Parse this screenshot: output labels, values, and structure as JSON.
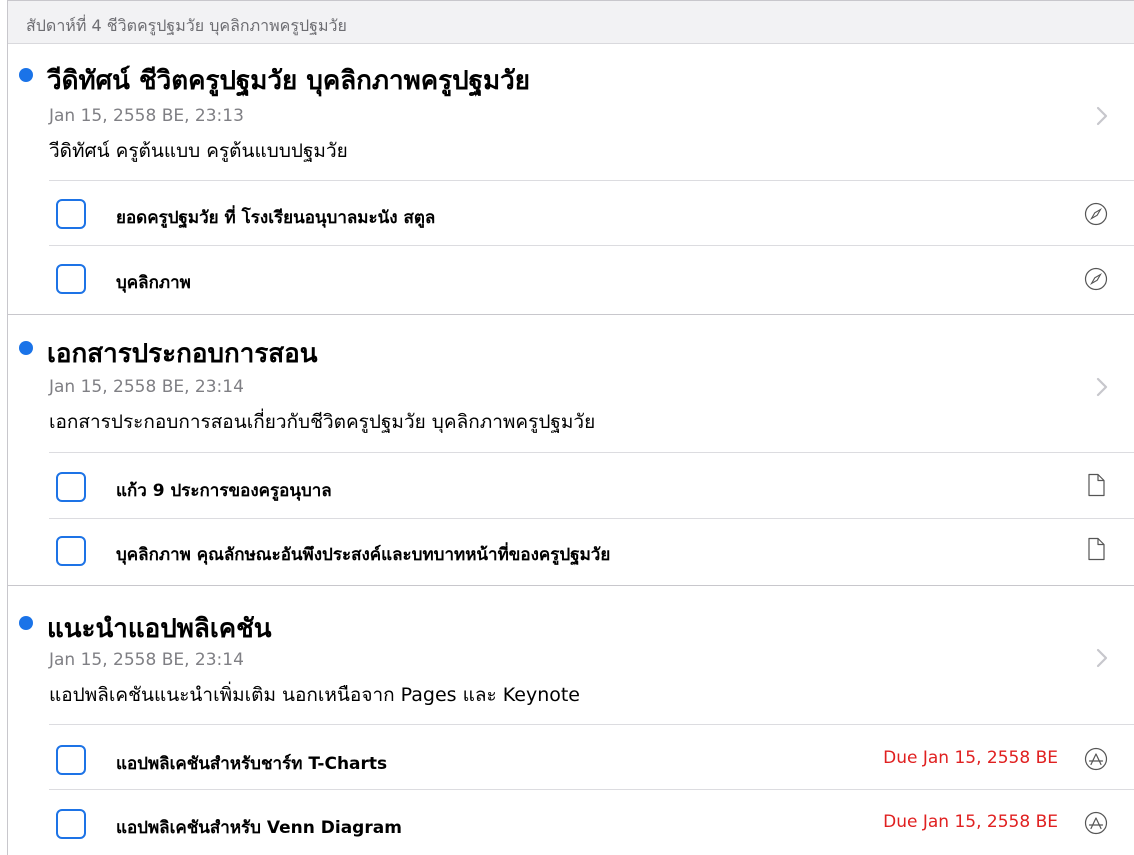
{
  "header": {
    "title": "สัปดาห์ที่ 4 ชีวิตครูปฐมวัย บุคลิกภาพครูปฐมวัย"
  },
  "colors": {
    "accent": "#1a73e8",
    "due": "#e02020",
    "secondary_text": "#7f7f84"
  },
  "groups": [
    {
      "title": "วีดิทัศน์ ชีวิตครูปฐมวัย บุคลิกภาพครูปฐมวัย",
      "date": "Jan 15, 2558 BE, 23:13",
      "description": "วีดิทัศน์ ครูต้นแบบ ครูต้นแบบปฐมวัย",
      "items": [
        {
          "label": "ยอดครูปฐมวัย ที่ โรงเรียนอนุบาลมะนัง สตูล",
          "due": "",
          "icon": "compass-icon"
        },
        {
          "label": "บุคลิกภาพ",
          "due": "",
          "icon": "compass-icon"
        }
      ]
    },
    {
      "title": "เอกสารประกอบการสอน",
      "date": "Jan 15, 2558 BE, 23:14",
      "description": "เอกสารประกอบการสอนเกี่ยวกับชีวิตครูปฐมวัย บุคลิกภาพครูปฐมวัย",
      "items": [
        {
          "label": "แก้ว 9 ประการของครูอนุบาล",
          "due": "",
          "icon": "document-icon"
        },
        {
          "label": "บุคลิกภาพ คุณลักษณะอันพึงประสงค์และบทบาทหน้าที่ของครูปฐมวัย",
          "due": "",
          "icon": "document-icon"
        }
      ]
    },
    {
      "title": "แนะนำแอปพลิเคชัน",
      "date": "Jan 15, 2558 BE, 23:14",
      "description": "แอปพลิเคชันแนะนำเพิ่มเติม นอกเหนือจาก Pages และ Keynote",
      "items": [
        {
          "label": "แอปพลิเคชันสำหรับชาร์ท T-Charts",
          "due": "Due Jan 15, 2558 BE",
          "icon": "app-store-icon"
        },
        {
          "label": "แอปพลิเคชันสำหรับ Venn Diagram",
          "due": "Due Jan 15, 2558 BE",
          "icon": "app-store-icon"
        }
      ]
    }
  ]
}
